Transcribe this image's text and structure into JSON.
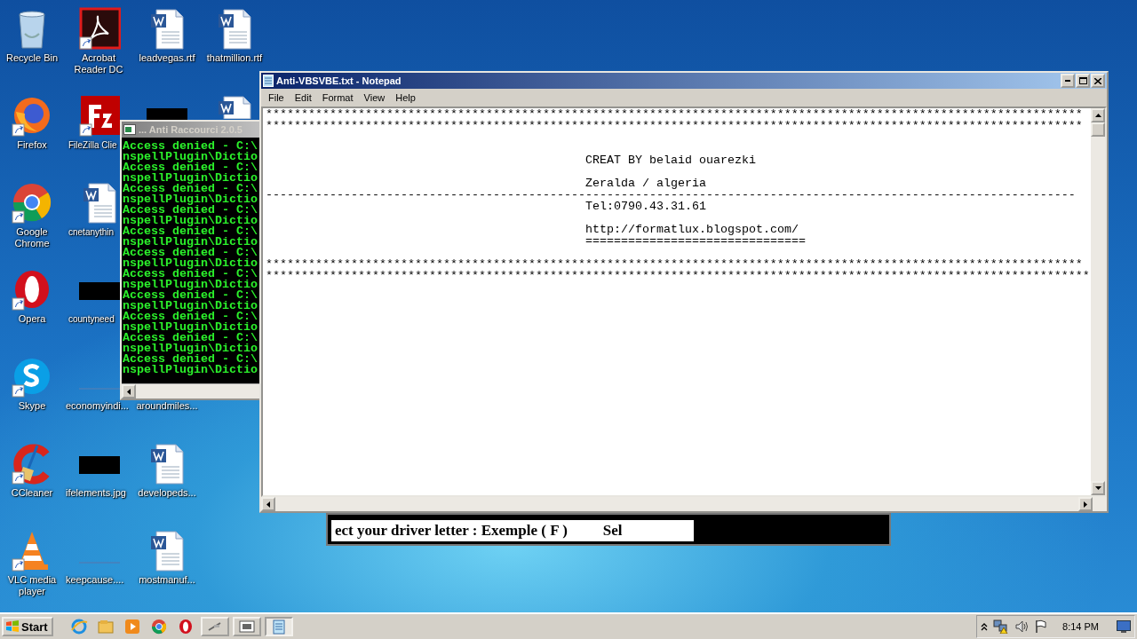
{
  "desktop_icons": [
    {
      "kind": "recycle-bin",
      "label": "Recycle Bin",
      "shortcut": false
    },
    {
      "kind": "firefox",
      "label": "Firefox",
      "shortcut": true
    },
    {
      "kind": "chrome",
      "label": "Google Chrome",
      "shortcut": true
    },
    {
      "kind": "opera",
      "label": "Opera",
      "shortcut": true
    },
    {
      "kind": "skype",
      "label": "Skype",
      "shortcut": true
    },
    {
      "kind": "ccleaner",
      "label": "CCleaner",
      "shortcut": true
    },
    {
      "kind": "vlc",
      "label": "VLC media player",
      "shortcut": true
    },
    {
      "kind": "acrobat",
      "label": "Acrobat Reader DC",
      "shortcut": true
    },
    {
      "kind": "filezilla",
      "label": "FileZilla Clie",
      "shortcut": true
    },
    {
      "kind": "word",
      "label": "cnetanythin",
      "shortcut": false
    },
    {
      "kind": "thumb",
      "label": "countyneed",
      "shortcut": false
    },
    {
      "kind": "line-thumb",
      "label": "economyindi...",
      "shortcut": false
    },
    {
      "kind": "thumb",
      "label": "ifelements.jpg",
      "shortcut": false
    },
    {
      "kind": "line-thumb",
      "label": "keepcause....",
      "shortcut": false
    },
    {
      "kind": "word",
      "label": "leadvegas.rtf",
      "shortcut": false
    },
    {
      "kind": "thumb"
    },
    {
      "kind": "blank"
    },
    {
      "kind": "blank"
    },
    {
      "kind": "blank",
      "label": "aroundmiles..."
    },
    {
      "kind": "word",
      "label": "developeds...",
      "shortcut": false
    },
    {
      "kind": "word",
      "label": "mostmanuf...",
      "shortcut": false
    },
    {
      "kind": "word",
      "label": "thatmillion.rtf",
      "shortcut": false
    },
    {
      "kind": "word-partial"
    }
  ],
  "console_window": {
    "title": "... Anti Raccourci 2.0.5",
    "active": false,
    "lines": [
      "Access denied - C:\\",
      "nspellPlugin\\Dictio",
      "Access denied - C:\\",
      "nspellPlugin\\Dictio",
      "Access denied - C:\\",
      "nspellPlugin\\Dictio",
      "Access denied - C:\\",
      "nspellPlugin\\Dictio",
      "Access denied - C:\\",
      "nspellPlugin\\Dictio",
      "Access denied - C:\\",
      "nspellPlugin\\Dictio",
      "Access denied - C:\\",
      "nspellPlugin\\Dictio",
      "Access denied - C:\\",
      "nspellPlugin\\Dictio",
      "Access denied - C:\\",
      "nspellPlugin\\Dictio",
      "Access denied - C:\\",
      "nspellPlugin\\Dictio",
      "Access denied - C:\\",
      "nspellPlugin\\Dictio"
    ]
  },
  "drive_prompt": {
    "text": "ect your driver letter : Exemple ( F )",
    "text_2": "Sel"
  },
  "notepad": {
    "title": "Anti-VBSVBE.txt - Notepad",
    "active": true,
    "menu": [
      "File",
      "Edit",
      "Format",
      "View",
      "Help"
    ],
    "lines": [
      {
        "kind": "block",
        "text": "*******************************************************************************************************************\n*******************************************************************************************************************"
      },
      {
        "kind": "blank"
      },
      {
        "kind": "blank"
      },
      {
        "kind": "indented",
        "text": "CREAT BY belaid ouarezki"
      },
      {
        "kind": "blank"
      },
      {
        "kind": "indented",
        "text": "Zeralda / algeria"
      },
      {
        "kind": "line",
        "text": "------------------------------------------------------------------------------------------------------------------"
      },
      {
        "kind": "indented",
        "text": "Tel:0790.43.31.61"
      },
      {
        "kind": "blank"
      },
      {
        "kind": "indented",
        "text": "http://formatlux.blogspot.com/"
      },
      {
        "kind": "indented",
        "text": "==============================="
      },
      {
        "kind": "blank"
      },
      {
        "kind": "block",
        "text": "*******************************************************************************************************************\n********************************************************************************************************************"
      }
    ]
  },
  "taskbar": {
    "start": "Start",
    "quick_launch": [
      {
        "kind": "ie"
      },
      {
        "kind": "explorer"
      },
      {
        "kind": "media"
      },
      {
        "kind": "chrome"
      },
      {
        "kind": "opera"
      }
    ],
    "tasks": [
      {
        "kind": "app",
        "selected": false
      },
      {
        "kind": "console",
        "selected": false
      },
      {
        "kind": "notepad",
        "selected": true
      }
    ],
    "clock": "8:14 PM"
  }
}
